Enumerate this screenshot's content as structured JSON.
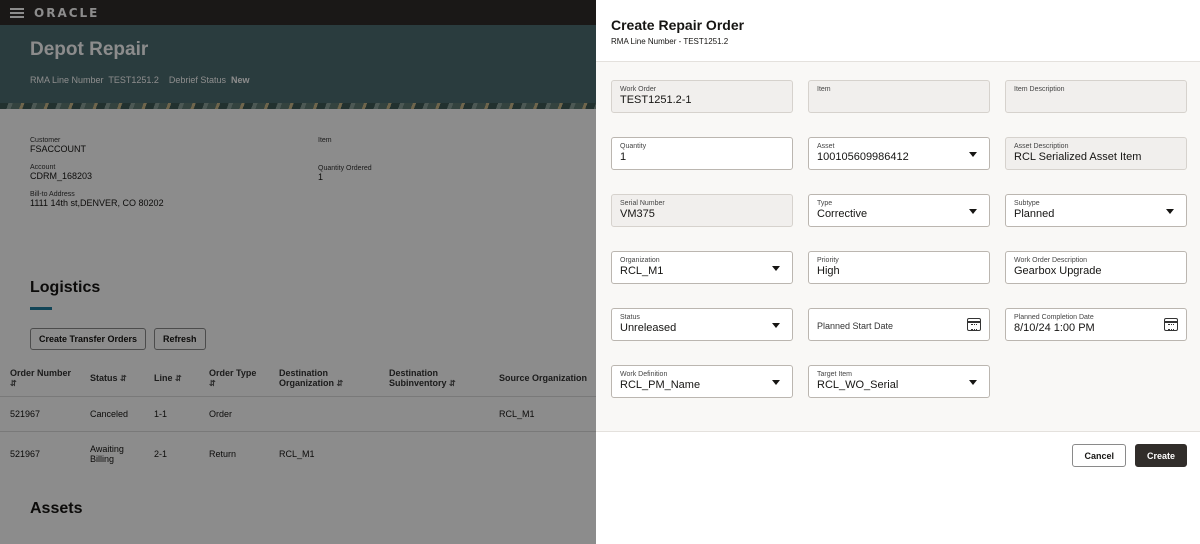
{
  "topbar": {
    "logo": "ORACLE"
  },
  "header": {
    "app_title": "Depot Repair",
    "rma_label": "RMA Line Number",
    "rma_value": "TEST1251.2",
    "debrief_label": "Debrief Status",
    "debrief_value": "New"
  },
  "info": {
    "customer_label": "Customer",
    "customer_value": "FSACCOUNT",
    "account_label": "Account",
    "account_value": "CDRM_168203",
    "billto_label": "Bill-to Address",
    "billto_value": "1111 14th st,DENVER, CO 80202",
    "item_label": "Item",
    "qty_label": "Quantity Ordered",
    "qty_value": "1"
  },
  "logistics": {
    "title": "Logistics",
    "create_transfer_label": "Create Transfer Orders",
    "refresh_label": "Refresh",
    "columns": [
      "Order Number",
      "Status",
      "Line",
      "Order Type",
      "Destination Organization",
      "Destination Subinventory",
      "Source Organization"
    ],
    "rows": [
      [
        "521967",
        "Canceled",
        "1-1",
        "Order",
        "",
        "",
        "RCL_M1"
      ],
      [
        "521967",
        "Awaiting Billing",
        "2-1",
        "Return",
        "RCL_M1",
        "",
        ""
      ]
    ]
  },
  "assets": {
    "title": "Assets"
  },
  "drawer": {
    "title": "Create Repair Order",
    "subtitle": "RMA Line Number - TEST1251.2",
    "fields": {
      "work_order": {
        "label": "Work Order",
        "value": "TEST1251.2-1"
      },
      "item": {
        "label": "Item",
        "value": ""
      },
      "item_desc": {
        "label": "Item Description",
        "value": ""
      },
      "quantity": {
        "label": "Quantity",
        "value": "1"
      },
      "asset": {
        "label": "Asset",
        "value": "100105609986412"
      },
      "asset_desc": {
        "label": "Asset Description",
        "value": "RCL Serialized Asset Item"
      },
      "serial": {
        "label": "Serial Number",
        "value": "VM375"
      },
      "type": {
        "label": "Type",
        "value": "Corrective"
      },
      "subtype": {
        "label": "Subtype",
        "value": "Planned"
      },
      "organization": {
        "label": "Organization",
        "value": "RCL_M1"
      },
      "priority": {
        "label": "Priority",
        "value": "High"
      },
      "wo_desc": {
        "label": "Work Order Description",
        "value": "Gearbox Upgrade"
      },
      "status": {
        "label": "Status",
        "value": "Unreleased"
      },
      "planned_start": {
        "label": "Planned Start Date",
        "value": ""
      },
      "planned_completion": {
        "label": "Planned Completion Date",
        "value": "8/10/24 1:00 PM"
      },
      "work_def": {
        "label": "Work Definition",
        "value": "RCL_PM_Name"
      },
      "target_item": {
        "label": "Target Item",
        "value": "RCL_WO_Serial"
      }
    },
    "cancel_label": "Cancel",
    "create_label": "Create"
  }
}
